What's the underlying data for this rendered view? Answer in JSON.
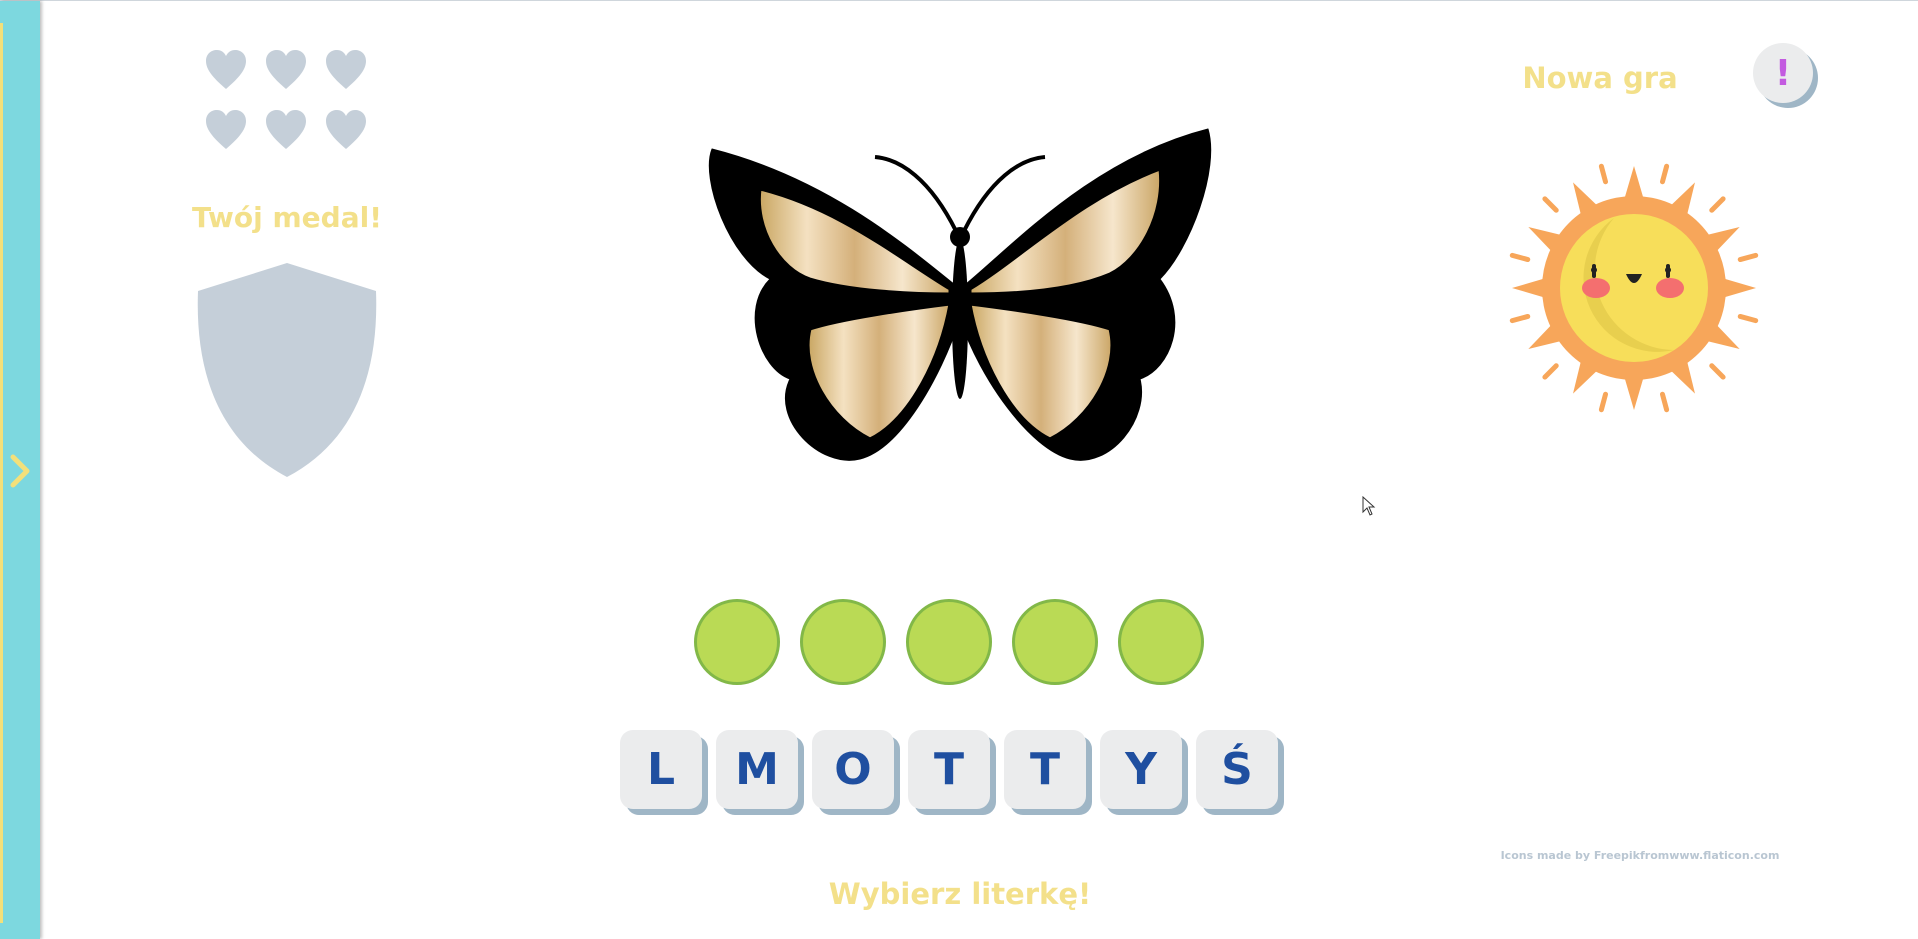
{
  "sidebar": {
    "toggle_icon": "chevron-right-icon"
  },
  "lives": {
    "count": 6,
    "icon": "heart-icon",
    "color": "#c5cfd9"
  },
  "medal": {
    "title": "Twój medal!",
    "icon": "shield-icon"
  },
  "header": {
    "new_game_label": "Nowa gra",
    "info_label": "!"
  },
  "picture": {
    "icon": "butterfly-icon"
  },
  "mascot": {
    "icon": "sun-icon"
  },
  "answer_slots": {
    "count": 5,
    "color": "#bada55"
  },
  "letters": [
    "L",
    "M",
    "O",
    "T",
    "T",
    "Y",
    "Ś"
  ],
  "credit": "Icons made by Freepikfromwww.flaticon.com",
  "prompt": "Wybierz literkę!",
  "colors": {
    "accent_yellow": "#f3e08a",
    "sidebar": "#7dd8df",
    "tile_text": "#1f4fa0",
    "info_mark": "#c35be0"
  }
}
